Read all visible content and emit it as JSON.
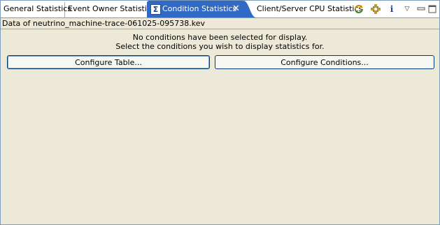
{
  "tabs": [
    {
      "label": "General Statistics",
      "active": false
    },
    {
      "label": "Event Owner Statistics",
      "active": false
    },
    {
      "label": "Condition Statistics",
      "active": true,
      "icon": "sigma-icon"
    },
    {
      "label": "Client/Server CPU Statistics",
      "active": false
    }
  ],
  "tab_active_close": "✕",
  "toolbar": {
    "icons": [
      "refresh-icon",
      "configure-icon",
      "info-icon",
      "view-menu-icon",
      "minimize-icon",
      "maximize-icon"
    ],
    "info_glyph": "i",
    "menu_glyph": "▽"
  },
  "source_label": "Data of neutrino_machine-trace-061025-095738.kev",
  "message": {
    "line1": "No conditions have been selected for display.",
    "line2": "Select the conditions you wish to display statistics for."
  },
  "buttons": {
    "configure_table": "Configure Table...",
    "configure_conditions": "Configure Conditions..."
  },
  "colors": {
    "active_tab": "#316ac5",
    "panel_background": "#ece9d8",
    "border": "#7f9db9"
  }
}
